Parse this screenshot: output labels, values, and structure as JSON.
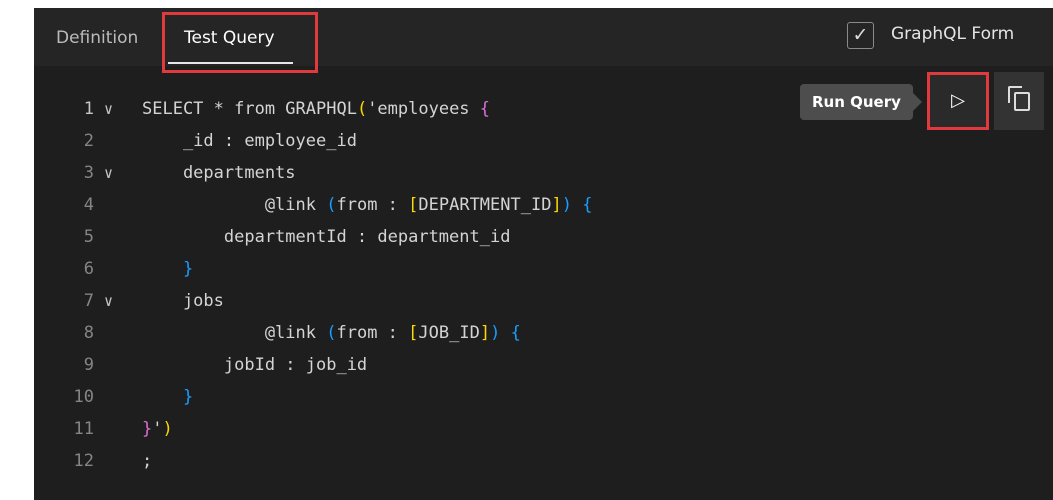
{
  "tabs": {
    "definition": "Definition",
    "test_query": "Test Query"
  },
  "graphql_form": {
    "checked": true,
    "label": "GraphQL Form",
    "check_glyph": "✓"
  },
  "toolbar": {
    "run_tooltip": "Run Query",
    "run_icon": "▷",
    "copy_icon": "copy-icon"
  },
  "code_lines": [
    {
      "n": "1",
      "fold": "∨",
      "parts": [
        {
          "t": "SELECT * from GRAPHQL",
          "c": ""
        },
        {
          "t": "(",
          "c": "b2"
        },
        {
          "t": "'employees ",
          "c": ""
        },
        {
          "t": "{",
          "c": "b1"
        }
      ]
    },
    {
      "n": "2",
      "fold": "",
      "parts": [
        {
          "t": "    _id : employee_id",
          "c": ""
        }
      ]
    },
    {
      "n": "3",
      "fold": "∨",
      "parts": [
        {
          "t": "    departments",
          "c": ""
        }
      ]
    },
    {
      "n": "4",
      "fold": "",
      "parts": [
        {
          "t": "            @link ",
          "c": ""
        },
        {
          "t": "(",
          "c": "b3"
        },
        {
          "t": "from : ",
          "c": ""
        },
        {
          "t": "[",
          "c": "b2"
        },
        {
          "t": "DEPARTMENT_ID",
          "c": ""
        },
        {
          "t": "]",
          "c": "b2"
        },
        {
          "t": ")",
          "c": "b3"
        },
        {
          "t": " ",
          "c": ""
        },
        {
          "t": "{",
          "c": "b3"
        }
      ]
    },
    {
      "n": "5",
      "fold": "",
      "parts": [
        {
          "t": "        departmentId : department_id",
          "c": ""
        }
      ]
    },
    {
      "n": "6",
      "fold": "",
      "parts": [
        {
          "t": "    ",
          "c": ""
        },
        {
          "t": "}",
          "c": "b3"
        }
      ]
    },
    {
      "n": "7",
      "fold": "∨",
      "parts": [
        {
          "t": "    jobs",
          "c": ""
        }
      ]
    },
    {
      "n": "8",
      "fold": "",
      "parts": [
        {
          "t": "            @link ",
          "c": ""
        },
        {
          "t": "(",
          "c": "b3"
        },
        {
          "t": "from : ",
          "c": ""
        },
        {
          "t": "[",
          "c": "b2"
        },
        {
          "t": "JOB_ID",
          "c": ""
        },
        {
          "t": "]",
          "c": "b2"
        },
        {
          "t": ")",
          "c": "b3"
        },
        {
          "t": " ",
          "c": ""
        },
        {
          "t": "{",
          "c": "b3"
        }
      ]
    },
    {
      "n": "9",
      "fold": "",
      "parts": [
        {
          "t": "        jobId : job_id",
          "c": ""
        }
      ]
    },
    {
      "n": "10",
      "fold": "",
      "parts": [
        {
          "t": "    ",
          "c": ""
        },
        {
          "t": "}",
          "c": "b3"
        }
      ]
    },
    {
      "n": "11",
      "fold": "",
      "parts": [
        {
          "t": "}",
          "c": "b1"
        },
        {
          "t": "'",
          "c": ""
        },
        {
          "t": ")",
          "c": "b2"
        }
      ]
    },
    {
      "n": "12",
      "fold": "",
      "parts": [
        {
          "t": ";",
          "c": ""
        }
      ]
    }
  ],
  "colors": {
    "highlight": "#e0393e",
    "editor_bg": "#1e1e1e",
    "bracket_level1": "#da70d6",
    "bracket_level2": "#ffd700",
    "bracket_level3": "#179fff"
  }
}
